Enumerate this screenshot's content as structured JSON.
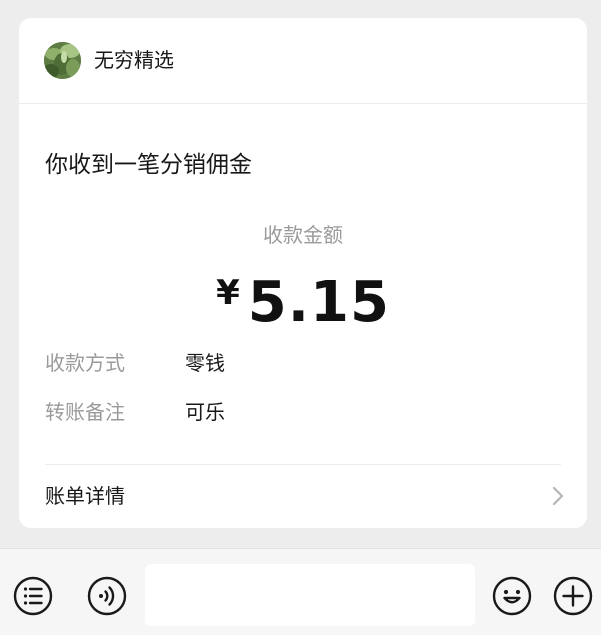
{
  "sender": {
    "name": "无穷精选",
    "avatar_icon": "plant-photo-avatar"
  },
  "message": {
    "title": "你收到一笔分销佣金",
    "amount_label": "收款金额",
    "currency_symbol": "¥",
    "amount": "5.15",
    "fields": [
      {
        "label": "收款方式",
        "value": "零钱"
      },
      {
        "label": "转账备注",
        "value": "可乐"
      }
    ],
    "detail_link_label": "账单详情"
  },
  "input_bar": {
    "left_icons": [
      "menu-list-icon",
      "voice-icon"
    ],
    "text_value": "",
    "right_icons": [
      "emoji-icon",
      "plus-icon"
    ]
  },
  "colors": {
    "background": "#ededed",
    "card": "#ffffff",
    "primary_text": "#181818",
    "secondary_text": "#9a9a9a",
    "divider": "#ececec"
  }
}
